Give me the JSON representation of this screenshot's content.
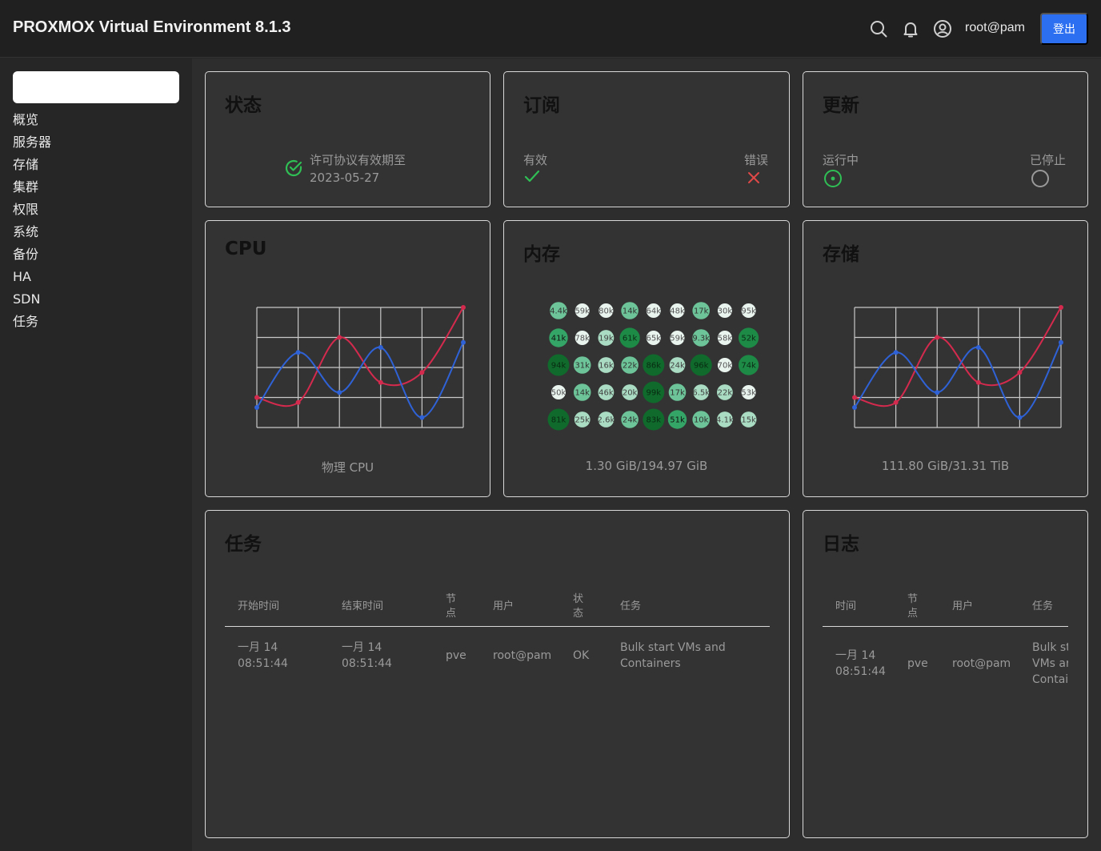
{
  "header": {
    "title": "PROXMOX Virtual Environment 8.1.3",
    "user": "root@pam",
    "logout_label": "登出"
  },
  "sidebar": {
    "items": [
      "概览",
      "服务器",
      "存储",
      "集群",
      "权限",
      "系统",
      "备份",
      "HA",
      "SDN",
      "任务"
    ]
  },
  "status_card": {
    "title": "状态",
    "license_label": "许可协议有效期至",
    "license_date": "2023-05-27",
    "icon": "check-circle-icon"
  },
  "subscription_card": {
    "title": "订阅",
    "valid_label": "有效",
    "error_label": "错误"
  },
  "update_card": {
    "title": "更新",
    "running_label": "运行中",
    "stopped_label": "已停止"
  },
  "cpu_card": {
    "title": "CPU",
    "footer": "物理 CPU"
  },
  "memory_card": {
    "title": "内存",
    "footer": "1.30 GiB/194.97 GiB"
  },
  "storage_card": {
    "title": "存储",
    "footer": "111.80 GiB/31.31 TiB"
  },
  "colors": {
    "accent_blue": "#2c6ff0",
    "series_red": "#d42a4d",
    "series_blue": "#2f62d6",
    "ok_green": "#2fbf55",
    "error_red": "#e04848"
  },
  "chart_data": [
    {
      "type": "line",
      "x": [
        0,
        1,
        2,
        3,
        4,
        5
      ],
      "series": [
        {
          "values": [
            6,
            5,
            18,
            9,
            11,
            24
          ]
        },
        {
          "values": [
            4,
            15,
            7,
            16,
            2,
            17
          ]
        }
      ],
      "ylim": [
        0,
        24
      ],
      "grid": true
    },
    {
      "type": "heatmap",
      "rows": [
        [
          "4.4k",
          "59k",
          "80k",
          "14k",
          "64k",
          "48k",
          "17k",
          "30k",
          "95k"
        ],
        [
          "41k",
          "78k",
          "19k",
          "61k",
          "65k",
          "59k",
          "9.3k",
          "58k",
          "52k"
        ],
        [
          "94k",
          "31k",
          "16k",
          "22k",
          "86k",
          "24k",
          "96k",
          "70k",
          "74k"
        ],
        [
          "50k",
          "14k",
          "46k",
          "20k",
          "99k",
          "17k",
          "6.5k",
          "22k",
          "53k"
        ],
        [
          "81k",
          "25k",
          "2.6k",
          "24k",
          "83k",
          "51k",
          "10k",
          "4.1k",
          "15k"
        ]
      ],
      "levels": [
        [
          2,
          0,
          0,
          2,
          0,
          0,
          2,
          0,
          0
        ],
        [
          3,
          0,
          1,
          4,
          0,
          0,
          2,
          0,
          4
        ],
        [
          5,
          2,
          1,
          2,
          5,
          1,
          5,
          0,
          4
        ],
        [
          0,
          2,
          1,
          1,
          5,
          2,
          1,
          1,
          0
        ],
        [
          5,
          1,
          1,
          2,
          5,
          3,
          2,
          1,
          1
        ]
      ]
    },
    {
      "type": "line",
      "x": [
        0,
        1,
        2,
        3,
        4,
        5
      ],
      "series": [
        {
          "values": [
            6,
            5,
            18,
            9,
            11,
            24
          ]
        },
        {
          "values": [
            4,
            15,
            7,
            16,
            2,
            17
          ]
        }
      ],
      "ylim": [
        0,
        24
      ],
      "grid": true
    }
  ],
  "tasks_card": {
    "title": "任务",
    "columns": [
      "开始时间",
      "结束时间",
      "节点",
      "用户",
      "状态",
      "任务"
    ],
    "rows": [
      [
        "一月 14\n08:51:44",
        "一月 14\n08:51:44",
        "pve",
        "root@pam",
        "OK",
        "Bulk start VMs and\nContainers"
      ]
    ]
  },
  "log_card": {
    "title": "日志",
    "columns": [
      "时间",
      "节点",
      "用户",
      "任务"
    ],
    "rows": [
      [
        "一月 14\n08:51:44",
        "pve",
        "root@pam",
        "Bulk st\nVMs ar\nContai"
      ]
    ]
  }
}
